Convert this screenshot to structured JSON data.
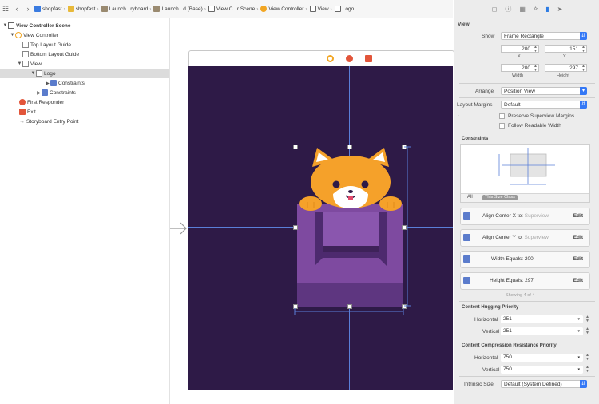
{
  "toolbar": {
    "breadcrumbs": [
      "shopfast",
      "shopfast",
      "Launch...ryboard",
      "Launch...d (Base)",
      "View C...r Scene",
      "View Controller",
      "View",
      "Logo"
    ]
  },
  "outline": [
    {
      "label": "View Controller Scene",
      "bold": true
    },
    {
      "label": "View Controller"
    },
    {
      "label": "Top Layout Guide"
    },
    {
      "label": "Bottom Layout Guide"
    },
    {
      "label": "View"
    },
    {
      "label": "Logo"
    },
    {
      "label": "Constraints"
    },
    {
      "label": "Constraints"
    },
    {
      "label": "First Responder"
    },
    {
      "label": "Exit"
    },
    {
      "label": "Storyboard Entry Point"
    }
  ],
  "inspector": {
    "view_header": "View",
    "show_label": "Show",
    "show_value": "Frame Rectangle",
    "frame": {
      "x": "200",
      "y": "151",
      "x_label": "X",
      "y_label": "Y",
      "width": "200",
      "height": "297",
      "width_label": "Width",
      "height_label": "Height"
    },
    "arrange_label": "Arrange",
    "arrange_value": "Position View",
    "margins_label": "Layout Margins",
    "margins_value": "Default",
    "preserve_label": "Preserve Superview Margins",
    "readable_label": "Follow Readable Width",
    "constraints_header": "Constraints",
    "tab_all": "All",
    "tab_size": "This Size Class",
    "constraints": [
      {
        "label": "Align Center X to:",
        "value": "Superview",
        "edit": "Edit"
      },
      {
        "label": "Align Center Y to:",
        "value": "Superview",
        "edit": "Edit"
      },
      {
        "label": "Width Equals:",
        "value": "200",
        "edit": "Edit"
      },
      {
        "label": "Height Equals:",
        "value": "297",
        "edit": "Edit"
      }
    ],
    "showing": "Showing 4 of 4",
    "hugging_header": "Content Hugging Priority",
    "hugging": {
      "h_label": "Horizontal",
      "h_value": "251",
      "v_label": "Vertical",
      "v_value": "251"
    },
    "compression_header": "Content Compression Resistance Priority",
    "compression": {
      "h_label": "Horizontal",
      "h_value": "750",
      "v_label": "Vertical",
      "v_value": "750"
    },
    "intrinsic_label": "Intrinsic Size",
    "intrinsic_value": "Default (System Defined)"
  },
  "colors": {
    "canvas_bg": "#2e1a47",
    "accent": "#3478f6",
    "guide": "#5a7fd8",
    "cat": "#f5a12a",
    "box": "#7e4aa0"
  }
}
